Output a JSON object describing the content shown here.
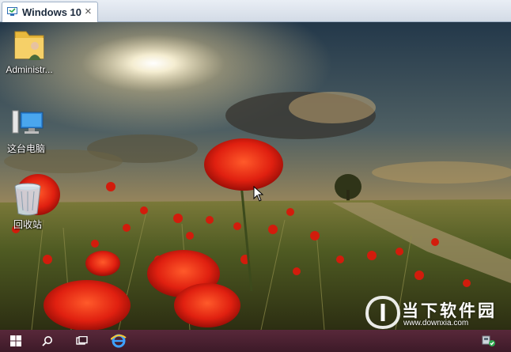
{
  "host": {
    "tab_title": "Windows 10",
    "tab_close": "×"
  },
  "desktop": {
    "icons": [
      {
        "label": "Administr...",
        "icon": "user-folder-icon"
      },
      {
        "label": "这台电脑",
        "icon": "this-pc-icon"
      },
      {
        "label": "回收站",
        "icon": "recycle-bin-icon"
      }
    ]
  },
  "watermark": {
    "title": "当下软件园",
    "url": "www.downxia.com"
  },
  "taskbar": {
    "buttons": [
      "start-icon",
      "search-icon",
      "task-view-icon",
      "edge-icon"
    ],
    "tray": [
      "network-icon"
    ]
  },
  "colors": {
    "taskbar": "#4a2030",
    "accent": "#0078d7"
  }
}
